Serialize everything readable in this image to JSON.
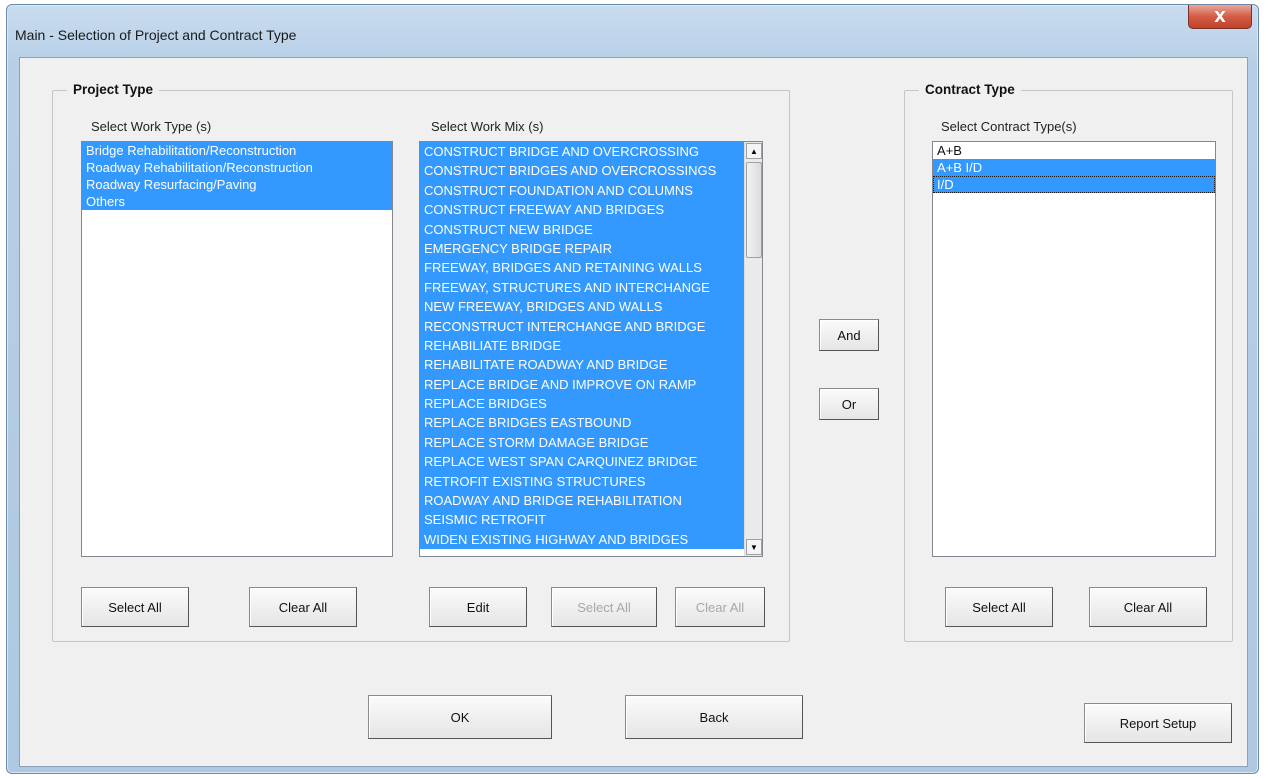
{
  "window": {
    "title": "Main - Selection of Project and Contract Type",
    "close_label": "X"
  },
  "project_type": {
    "group_title": "Project Type",
    "work_type_label": "Select Work Type (s)",
    "work_types": [
      {
        "label": "Bridge Rehabilitation/Reconstruction",
        "selected": true
      },
      {
        "label": "Roadway Rehabilitation/Reconstruction",
        "selected": true
      },
      {
        "label": "Roadway Resurfacing/Paving",
        "selected": true
      },
      {
        "label": "Others",
        "selected": true
      }
    ],
    "work_mix_label": "Select Work Mix (s)",
    "work_mix": [
      {
        "label": "CONSTRUCT BRIDGE AND OVERCROSSING",
        "selected": true
      },
      {
        "label": "CONSTRUCT BRIDGES AND OVERCROSSINGS",
        "selected": true
      },
      {
        "label": "CONSTRUCT FOUNDATION AND COLUMNS",
        "selected": true
      },
      {
        "label": "CONSTRUCT FREEWAY AND BRIDGES",
        "selected": true
      },
      {
        "label": "CONSTRUCT NEW BRIDGE",
        "selected": true
      },
      {
        "label": "EMERGENCY BRIDGE REPAIR",
        "selected": true
      },
      {
        "label": "FREEWAY, BRIDGES AND RETAINING WALLS",
        "selected": true
      },
      {
        "label": "FREEWAY, STRUCTURES AND INTERCHANGE",
        "selected": true
      },
      {
        "label": "NEW FREEWAY, BRIDGES AND WALLS",
        "selected": true
      },
      {
        "label": "RECONSTRUCT INTERCHANGE AND BRIDGE",
        "selected": true
      },
      {
        "label": "REHABILIATE BRIDGE",
        "selected": true
      },
      {
        "label": "REHABILITATE ROADWAY AND BRIDGE",
        "selected": true
      },
      {
        "label": "REPLACE BRIDGE AND IMPROVE ON RAMP",
        "selected": true
      },
      {
        "label": "REPLACE BRIDGES",
        "selected": true
      },
      {
        "label": "REPLACE BRIDGES EASTBOUND",
        "selected": true
      },
      {
        "label": "REPLACE STORM DAMAGE BRIDGE",
        "selected": true
      },
      {
        "label": "REPLACE WEST SPAN CARQUINEZ BRIDGE",
        "selected": true
      },
      {
        "label": "RETROFIT EXISTING STRUCTURES",
        "selected": true
      },
      {
        "label": "ROADWAY AND BRIDGE REHABILITATION",
        "selected": true
      },
      {
        "label": "SEISMIC RETROFIT",
        "selected": true
      },
      {
        "label": "WIDEN EXISTING HIGHWAY AND BRIDGES",
        "selected": true
      }
    ],
    "work_type_select_all": "Select All",
    "work_type_clear_all": "Clear All",
    "work_mix_edit": "Edit",
    "work_mix_select_all": "Select All",
    "work_mix_clear_all": "Clear All"
  },
  "logic": {
    "and_label": "And",
    "or_label": "Or"
  },
  "contract_type": {
    "group_title": "Contract Type",
    "list_label": "Select Contract Type(s)",
    "items": [
      {
        "label": "A+B",
        "selected": false
      },
      {
        "label": "A+B I/D",
        "selected": true
      },
      {
        "label": "I/D",
        "selected": true,
        "focused": true
      }
    ],
    "select_all": "Select All",
    "clear_all": "Clear All"
  },
  "footer": {
    "ok_label": "OK",
    "back_label": "Back",
    "report_setup_label": "Report Setup"
  },
  "colors": {
    "selection": "#3399ff",
    "dialog_bg": "#f0f0f0",
    "frame": "#b7cfe6"
  }
}
